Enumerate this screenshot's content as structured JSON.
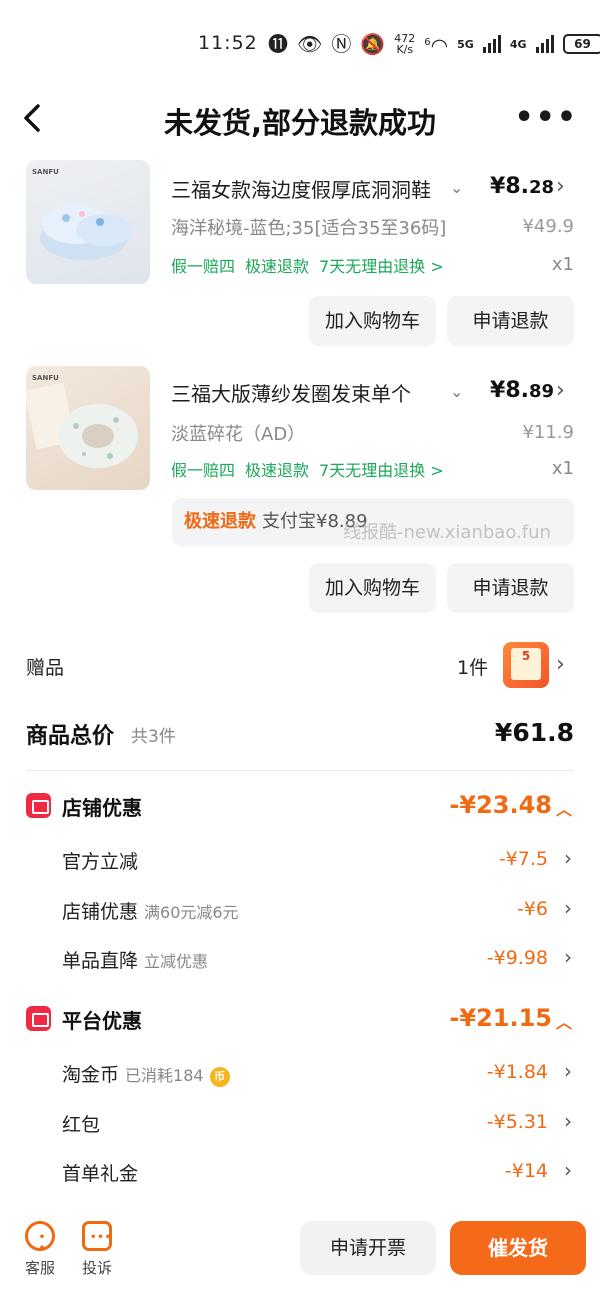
{
  "status_bar": {
    "time": "11:52",
    "speed_value": "472",
    "speed_unit": "K/s",
    "wifi_sup": "6",
    "net1": "5G",
    "net2": "4G",
    "battery": "69"
  },
  "header": {
    "title": "未发货,部分退款成功"
  },
  "products": [
    {
      "brand": "SANFU",
      "name": "三福女款海边度假厚底洞洞鞋",
      "price_symbol": "¥",
      "price_int": "8.",
      "price_dec": "28",
      "sku": "海洋秘境-蓝色;35[适合35至36码]",
      "original_price": "¥49.9",
      "tags": [
        "假一赔四",
        "极速退款",
        "7天无理由退换 >"
      ],
      "qty": "x1",
      "btn_cart": "加入购物车",
      "btn_refund": "申请退款"
    },
    {
      "brand": "SANFU",
      "name": "三福大版薄纱发圈发束单个",
      "price_symbol": "¥",
      "price_int": "8.",
      "price_dec": "89",
      "sku": "淡蓝碎花（AD）",
      "original_price": "¥11.9",
      "tags": [
        "假一赔四",
        "极速退款",
        "7天无理由退换 >"
      ],
      "qty": "x1",
      "refund_status": "极速退款",
      "refund_pay": "支付宝¥8.89",
      "btn_cart": "加入购物车",
      "btn_refund": "申请退款"
    }
  ],
  "watermark": "线报酷-new.xianbao.fun",
  "gift": {
    "label": "赠品",
    "count": "1件",
    "icon_text": "5"
  },
  "total": {
    "label": "商品总价",
    "count": "共3件",
    "value": "¥61.8"
  },
  "store_discount": {
    "title": "店铺优惠",
    "amount": "-¥23.48",
    "items": [
      {
        "label": "官方立减",
        "sub": "",
        "value": "-¥7.5"
      },
      {
        "label": "店铺优惠",
        "sub": "满60元减6元",
        "value": "-¥6"
      },
      {
        "label": "单品直降",
        "sub": "立减优惠",
        "value": "-¥9.98"
      }
    ]
  },
  "platform_discount": {
    "title": "平台优惠",
    "amount": "-¥21.15",
    "items": [
      {
        "label": "淘金币",
        "sub": "已消耗184",
        "value": "-¥1.84"
      },
      {
        "label": "红包",
        "sub": "",
        "value": "-¥5.31"
      },
      {
        "label": "首单礼金",
        "sub": "",
        "value": "-¥14"
      }
    ]
  },
  "bottom_bar": {
    "service_label": "客服",
    "complain_label": "投诉",
    "invoice_label": "申请开票",
    "urge_label": "催发货"
  },
  "colors": {
    "accent_orange": "#f06a13",
    "tag_green": "#1ca85a",
    "discount_red": "#ee2b43"
  }
}
